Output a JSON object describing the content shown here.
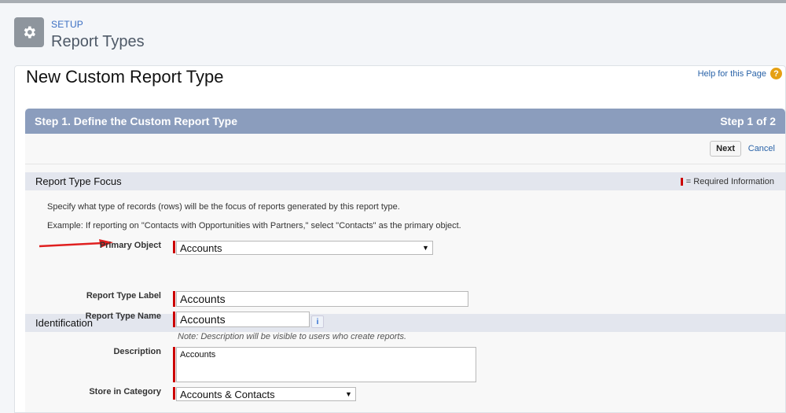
{
  "header": {
    "section_label": "SETUP",
    "title": "Report Types",
    "icon": "gear-icon"
  },
  "panel": {
    "title": "New Custom Report Type",
    "help_link": "Help for this Page",
    "help_icon": "?"
  },
  "step": {
    "title": "Step 1. Define the Custom Report Type",
    "progress": "Step 1 of 2",
    "next_label": "Next",
    "cancel_label": "Cancel"
  },
  "focus_section": {
    "title": "Report Type Focus",
    "required_legend": "= Required Information",
    "instruction": "Specify what type of records (rows) will be the focus of reports generated by this report type.",
    "example": "Example: If reporting on \"Contacts with Opportunities with Partners,\" select \"Contacts\" as the primary object.",
    "primary_object_label": "Primary Object",
    "primary_object_value": "Accounts"
  },
  "identification": {
    "title": "Identification",
    "label_label": "Report Type Label",
    "label_value": "Accounts",
    "name_label": "Report Type Name",
    "name_value": "Accounts",
    "info_icon": "i",
    "note": "Note: Description will be visible to users who create reports.",
    "description_label": "Description",
    "description_value": "Accounts",
    "category_label": "Store in Category",
    "category_value": "Accounts & Contacts"
  },
  "colors": {
    "step_header": "#8b9dbd",
    "required": "#cc0000",
    "link": "#2a63a8",
    "help_icon": "#e5a013"
  }
}
